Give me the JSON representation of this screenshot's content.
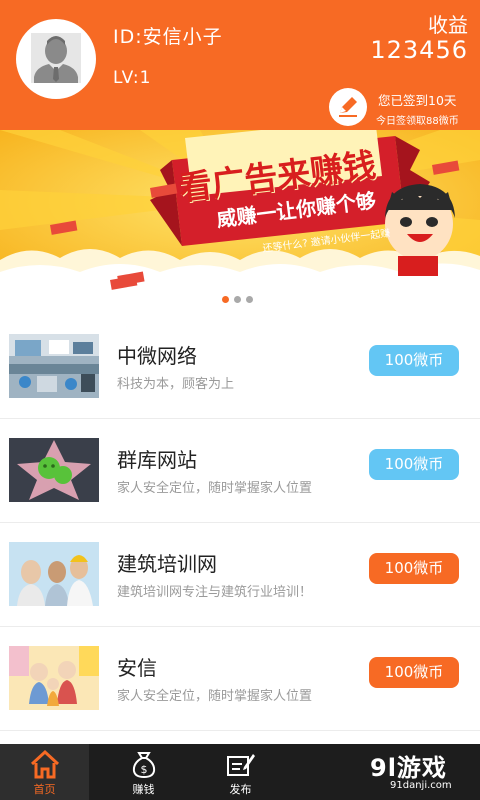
{
  "user": {
    "id_text": "ID:安信小子",
    "level_text": "LV:1"
  },
  "income": {
    "label": "收益",
    "value": "123456"
  },
  "signin": {
    "days_text": "您已签到10天",
    "reward_text": "今日签领取88微币"
  },
  "banner": {
    "title": "看广告来赚钱",
    "subtitle": "威赚一让你赚个够",
    "note": "还等什么? 邀请小伙伴一起赚",
    "page_count": 3,
    "active_index": 0
  },
  "list": [
    {
      "title": "中微网络",
      "desc": "科技为本，顾客为上",
      "reward": "100微币",
      "reward_color": "#63c6f4"
    },
    {
      "title": "群库网站",
      "desc": "家人安全定位，随时掌握家人位置",
      "reward": "100微币",
      "reward_color": "#63c6f4"
    },
    {
      "title": "建筑培训网",
      "desc": "建筑培训网专注与建筑行业培训！",
      "reward": "100微币",
      "reward_color": "#f76a24"
    },
    {
      "title": "安信",
      "desc": "家人安全定位，随时掌握家人位置",
      "reward": "100微币",
      "reward_color": "#f76a24"
    }
  ],
  "tabs": [
    {
      "label": "首页",
      "icon": "home-icon",
      "active": true
    },
    {
      "label": "赚钱",
      "icon": "money-bag-icon",
      "active": false
    },
    {
      "label": "发布",
      "icon": "publish-icon",
      "active": false
    }
  ],
  "watermark": {
    "main": "9l游戏",
    "sub": "91danji.com"
  },
  "colors": {
    "accent": "#f76a24",
    "blue_button": "#63c6f4",
    "tabbar": "#1d1d1d"
  }
}
